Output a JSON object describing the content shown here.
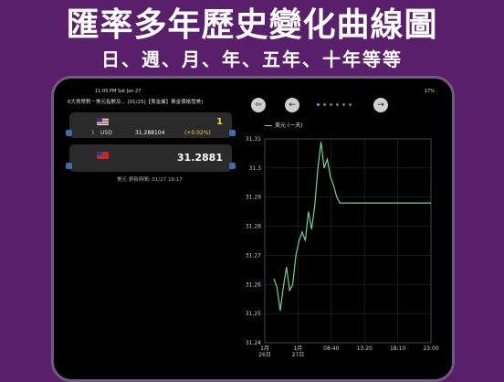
{
  "headline": {
    "line1": "匯率多年歷史變化曲線圖",
    "line2": "日、週、月、年、五年、十年等等"
  },
  "statusbar": {
    "time": "11:05 PM   Sat Jan 27",
    "right": "17%"
  },
  "ticker": "6大貨幣對－美元指數及...  [01/25]【貴金屬】黃金價格發美)",
  "card1": {
    "amount": "1",
    "index": "1",
    "currency": "USD",
    "rate": "31.288104",
    "change": "(+0.02%)"
  },
  "card2": {
    "value": "31.2881"
  },
  "updated": "美元 更新時間: 01/27 16:17",
  "controls": {
    "left_btn": "⇦",
    "back_btn": "←",
    "forward_btn": "→"
  },
  "legend": "美元 (一天)",
  "chart_data": {
    "type": "line",
    "series": [
      {
        "name": "美元 (一天)",
        "color": "#6ed49b",
        "points": [
          [
            0.0,
            31.262
          ],
          [
            0.02,
            31.259
          ],
          [
            0.04,
            31.251
          ],
          [
            0.06,
            31.259
          ],
          [
            0.08,
            31.266
          ],
          [
            0.1,
            31.258
          ],
          [
            0.12,
            31.26
          ],
          [
            0.14,
            31.27
          ],
          [
            0.16,
            31.275
          ],
          [
            0.18,
            31.278
          ],
          [
            0.2,
            31.275
          ],
          [
            0.22,
            31.285
          ],
          [
            0.24,
            31.279
          ],
          [
            0.26,
            31.287
          ],
          [
            0.28,
            31.3
          ],
          [
            0.3,
            31.309
          ],
          [
            0.32,
            31.3
          ],
          [
            0.34,
            31.303
          ],
          [
            0.36,
            31.297
          ],
          [
            0.38,
            31.294
          ],
          [
            0.4,
            31.29
          ],
          [
            0.42,
            31.288
          ],
          [
            1.0,
            31.288
          ]
        ]
      }
    ],
    "ylim": [
      31.24,
      31.31
    ],
    "yticks": [
      "31.31",
      "31.3",
      "31.29",
      "31.28",
      "31.27",
      "31.26",
      "31.25",
      "31.24"
    ],
    "xticks": [
      "1月\n26日",
      "1月\n27日",
      "08:40",
      "13:20",
      "18:10",
      "23:00"
    ],
    "grid": true
  }
}
